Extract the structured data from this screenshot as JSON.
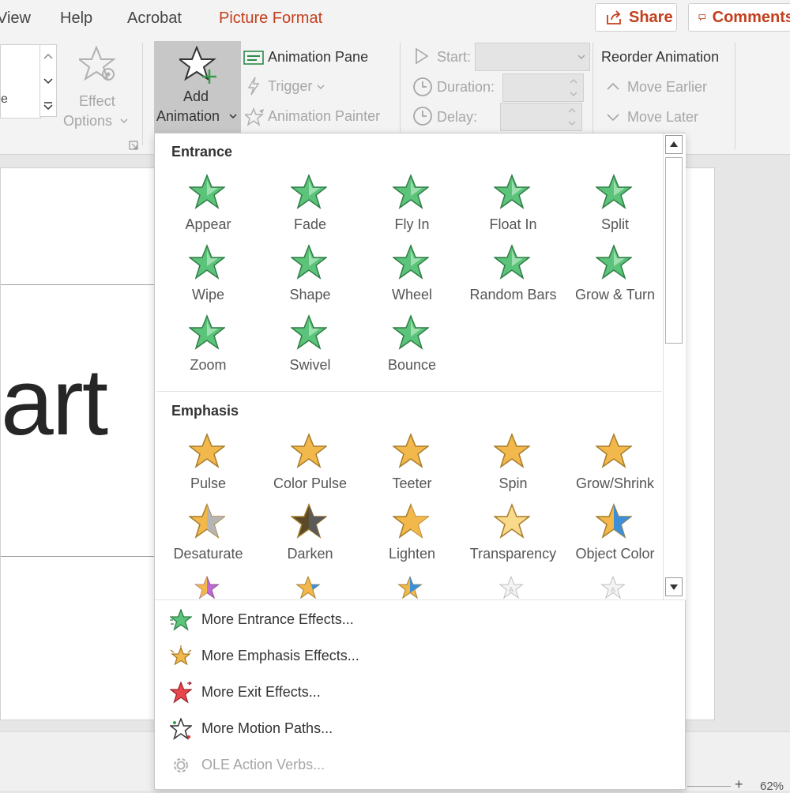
{
  "menubar": {
    "tabs": [
      "View",
      "Help",
      "Acrobat",
      "Picture Format"
    ],
    "share_label": "Share",
    "comments_label": "Comments"
  },
  "ribbon": {
    "effect_options_line1": "Effect",
    "effect_options_line2": "Options",
    "add_animation_line1": "Add",
    "add_animation_line2": "Animation",
    "animation_pane": "Animation Pane",
    "trigger": "Trigger",
    "animation_painter": "Animation Painter",
    "start_label": "Start:",
    "duration_label": "Duration:",
    "delay_label": "Delay:",
    "reorder_title": "Reorder Animation",
    "move_earlier": "Move Earlier",
    "move_later": "Move Later",
    "gallery_partial_text": "e"
  },
  "slide": {
    "text": "art"
  },
  "statusbar": {
    "zoom": "62%"
  },
  "dropdown": {
    "entrance_heading": "Entrance",
    "entrance_items": [
      "Appear",
      "Fade",
      "Fly In",
      "Float In",
      "Split",
      "Wipe",
      "Shape",
      "Wheel",
      "Random Bars",
      "Grow & Turn",
      "Zoom",
      "Swivel",
      "Bounce"
    ],
    "emphasis_heading": "Emphasis",
    "emphasis_items": [
      "Pulse",
      "Color Pulse",
      "Teeter",
      "Spin",
      "Grow/Shrink",
      "Desaturate",
      "Darken",
      "Lighten",
      "Transparency",
      "Object Color"
    ],
    "more_items": [
      "More Entrance Effects...",
      "More Emphasis Effects...",
      "More Exit Effects...",
      "More Motion Paths...",
      "OLE Action Verbs..."
    ]
  },
  "colors": {
    "accent": "#c43e1c",
    "entrance_green": "#5cc47a",
    "emphasis_gold": "#f2b84b",
    "exit_red": "#e8474d"
  }
}
